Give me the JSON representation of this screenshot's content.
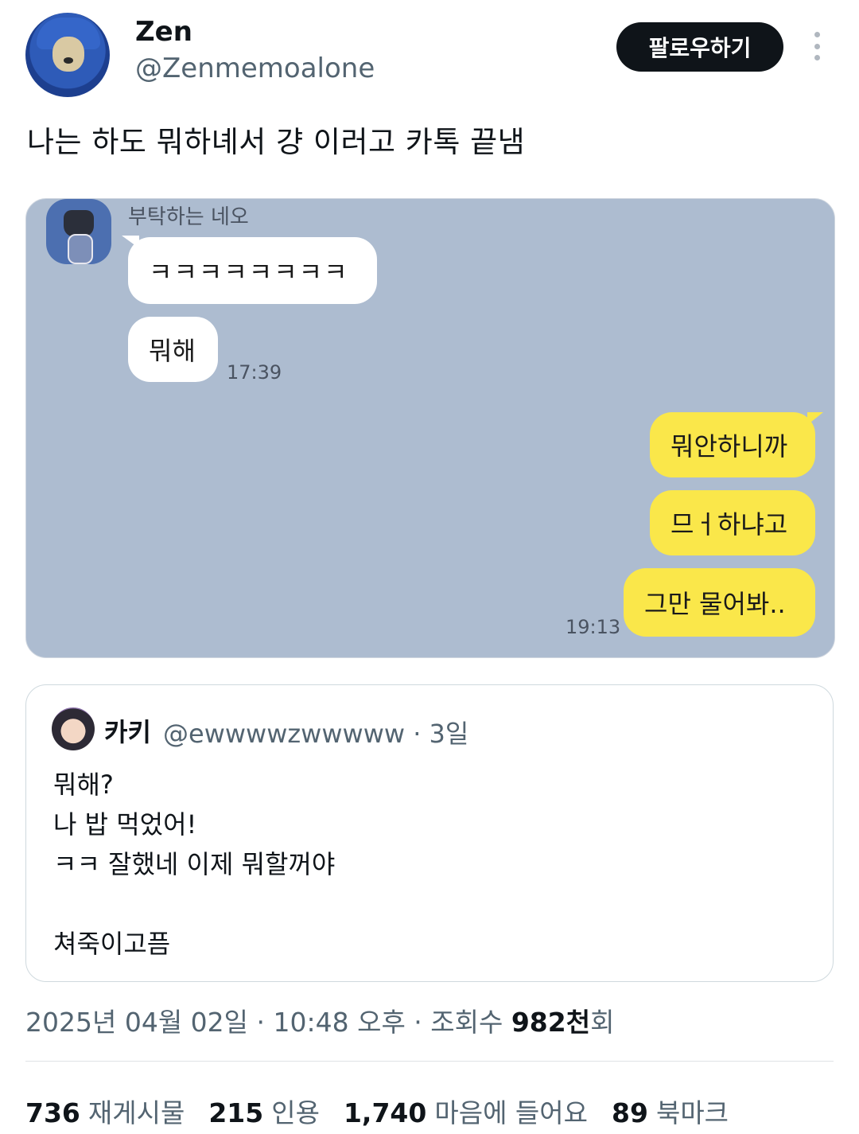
{
  "author": {
    "name": "Zen",
    "handle": "@Zenmemoalone",
    "follow_label": "팔로우하기"
  },
  "tweet": {
    "text": "나는 하도 뭐하녜서 걍 이러고 카톡 끝냄"
  },
  "chat_image": {
    "sender_name": "부탁하는 네오",
    "incoming": [
      "ㅋㅋㅋㅋㅋㅋㅋㅋ",
      "뭐해"
    ],
    "incoming_time": "17:39",
    "outgoing": [
      "뭐안하니까",
      "므ㅓ하냐고",
      "그만 물어봐.."
    ],
    "outgoing_time": "19:13",
    "colors": {
      "background": "#adbcd0",
      "outgoing_bubble": "#fae74a",
      "incoming_bubble": "#ffffff"
    }
  },
  "quoted_tweet": {
    "name": "카키",
    "handle_time": "@ewwwwzwwwww · 3일",
    "lines": [
      "뭐해?",
      "나 밥 먹었어!",
      "ㅋㅋ 잘했네 이제 뭐할꺼야",
      "",
      "쳐죽이고픔"
    ]
  },
  "meta": {
    "datetime": "2025년 04월 02일 · 10:48 오후 · 조회수 ",
    "views": "982천",
    "views_suffix": "회"
  },
  "stats": [
    {
      "count": "736",
      "label": "재게시물"
    },
    {
      "count": "215",
      "label": "인용"
    },
    {
      "count": "1,740",
      "label": "마음에 들어요"
    },
    {
      "count": "89",
      "label": "북마크"
    }
  ]
}
